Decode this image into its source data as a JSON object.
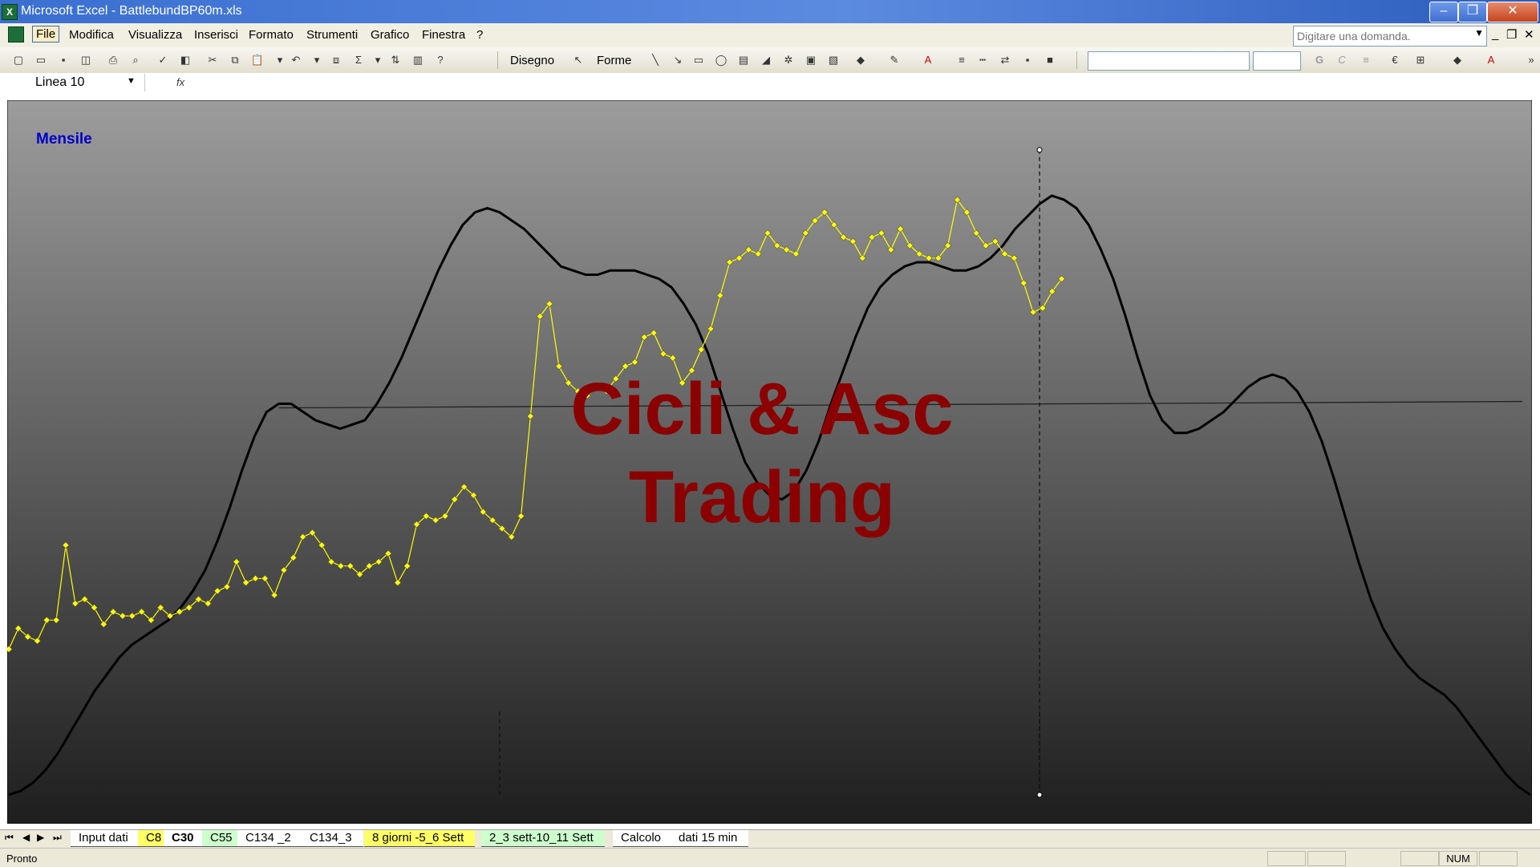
{
  "window": {
    "title": "Microsoft Excel - BattlebundBP60m.xls",
    "controls": [
      "minimize",
      "restore",
      "close"
    ]
  },
  "menu": {
    "items": [
      "File",
      "Modifica",
      "Visualizza",
      "Inserisci",
      "Formato",
      "Strumenti",
      "Grafico",
      "Finestra",
      "?"
    ],
    "active": "File",
    "help_placeholder": "Digitare una domanda."
  },
  "toolbar": {
    "drawing_label": "Disegno",
    "shapes_label": "Forme"
  },
  "formula_bar": {
    "name_box": "Linea 10",
    "fx_label": "fx"
  },
  "chart": {
    "label": "Mensile",
    "watermark_line1": "Cicli & Asc",
    "watermark_line2": "Trading",
    "background_top": "#9C9C9C",
    "background_bottom": "#1E1E1E",
    "price_color": "#FFFF00",
    "cycle_color": "#000000"
  },
  "chart_data": {
    "type": "line",
    "series": [
      {
        "values": [
          0.35,
          0.4,
          0.38,
          0.37,
          0.42,
          0.42,
          0.6,
          0.46,
          0.47,
          0.45,
          0.41,
          0.44,
          0.43,
          0.43,
          0.44,
          0.42,
          0.45,
          0.43,
          0.44,
          0.45,
          0.47,
          0.46,
          0.49,
          0.5,
          0.56,
          0.51,
          0.52,
          0.52,
          0.48,
          0.54,
          0.57,
          0.62,
          0.63,
          0.6,
          0.56,
          0.55,
          0.55,
          0.53,
          0.55,
          0.56,
          0.58,
          0.51,
          0.55,
          0.65,
          0.67,
          0.66,
          0.67,
          0.71,
          0.74,
          0.72,
          0.68,
          0.66,
          0.64,
          0.62,
          0.67,
          0.91,
          1.15,
          1.18,
          1.03,
          0.99,
          0.97,
          0.96,
          0.98,
          0.97,
          1.0,
          1.03,
          1.04,
          1.1,
          1.11,
          1.06,
          1.05,
          0.99,
          1.02,
          1.07,
          1.12,
          1.2,
          1.28,
          1.29,
          1.31,
          1.3,
          1.35,
          1.32,
          1.31,
          1.3,
          1.35,
          1.38,
          1.4,
          1.37,
          1.34,
          1.33,
          1.29,
          1.34,
          1.35,
          1.31,
          1.36,
          1.32,
          1.3,
          1.29,
          1.29,
          1.32,
          1.43,
          1.4,
          1.35,
          1.32,
          1.33,
          1.3,
          1.29,
          1.23,
          1.16,
          1.17,
          1.21,
          1.24
        ]
      },
      {
        "values": [
          0.0,
          0.01,
          0.03,
          0.06,
          0.1,
          0.15,
          0.2,
          0.25,
          0.29,
          0.33,
          0.36,
          0.38,
          0.4,
          0.42,
          0.45,
          0.49,
          0.54,
          0.61,
          0.69,
          0.78,
          0.86,
          0.92,
          0.94,
          0.94,
          0.92,
          0.9,
          0.89,
          0.88,
          0.89,
          0.9,
          0.94,
          0.99,
          1.05,
          1.12,
          1.19,
          1.26,
          1.32,
          1.37,
          1.4,
          1.41,
          1.4,
          1.38,
          1.36,
          1.33,
          1.3,
          1.27,
          1.26,
          1.25,
          1.25,
          1.26,
          1.26,
          1.26,
          1.25,
          1.24,
          1.22,
          1.18,
          1.13,
          1.06,
          0.97,
          0.88,
          0.8,
          0.75,
          0.72,
          0.71,
          0.73,
          0.78,
          0.85,
          0.94,
          1.02,
          1.1,
          1.17,
          1.22,
          1.25,
          1.27,
          1.28,
          1.28,
          1.27,
          1.26,
          1.26,
          1.27,
          1.29,
          1.32,
          1.36,
          1.39,
          1.42,
          1.44,
          1.43,
          1.41,
          1.37,
          1.31,
          1.24,
          1.15,
          1.05,
          0.96,
          0.9,
          0.87,
          0.87,
          0.88,
          0.9,
          0.92,
          0.95,
          0.98,
          1.0,
          1.01,
          1.0,
          0.97,
          0.92,
          0.85,
          0.76,
          0.66,
          0.56,
          0.47,
          0.4,
          0.35,
          0.31,
          0.28,
          0.26,
          0.24,
          0.21,
          0.17,
          0.13,
          0.09,
          0.05,
          0.02,
          0.0
        ]
      }
    ],
    "horizontal_line": {
      "value": 0.93,
      "x_start_index": 22
    },
    "dashed_verticals_index": [
      40,
      84
    ],
    "selected_vertical_index": 84,
    "right_marker_index": 130,
    "ylim": [
      -0.05,
      1.65
    ]
  },
  "sheet_tabs": [
    {
      "label": "Input dati",
      "color": "#FFFFFF"
    },
    {
      "label": "C8",
      "color": "#FFFF66"
    },
    {
      "label": "C30",
      "color": "#FFFFFF",
      "active": true
    },
    {
      "label": "C55",
      "color": "#CCFFCC"
    },
    {
      "label": "C134 _2",
      "color": "#FFFFFF"
    },
    {
      "label": "C134_3",
      "color": "#FFFFFF"
    },
    {
      "label": "8 giorni -5_6 Sett",
      "color": "#FFFF66"
    },
    {
      "label": "2_3 sett-10_11 Sett",
      "color": "#CCFFCC"
    },
    {
      "label": "Calcolo",
      "color": "#FFFFFF"
    },
    {
      "label": "dati 15 min",
      "color": "#FFFFFF"
    }
  ],
  "status": {
    "text": "Pronto",
    "num": "NUM"
  }
}
